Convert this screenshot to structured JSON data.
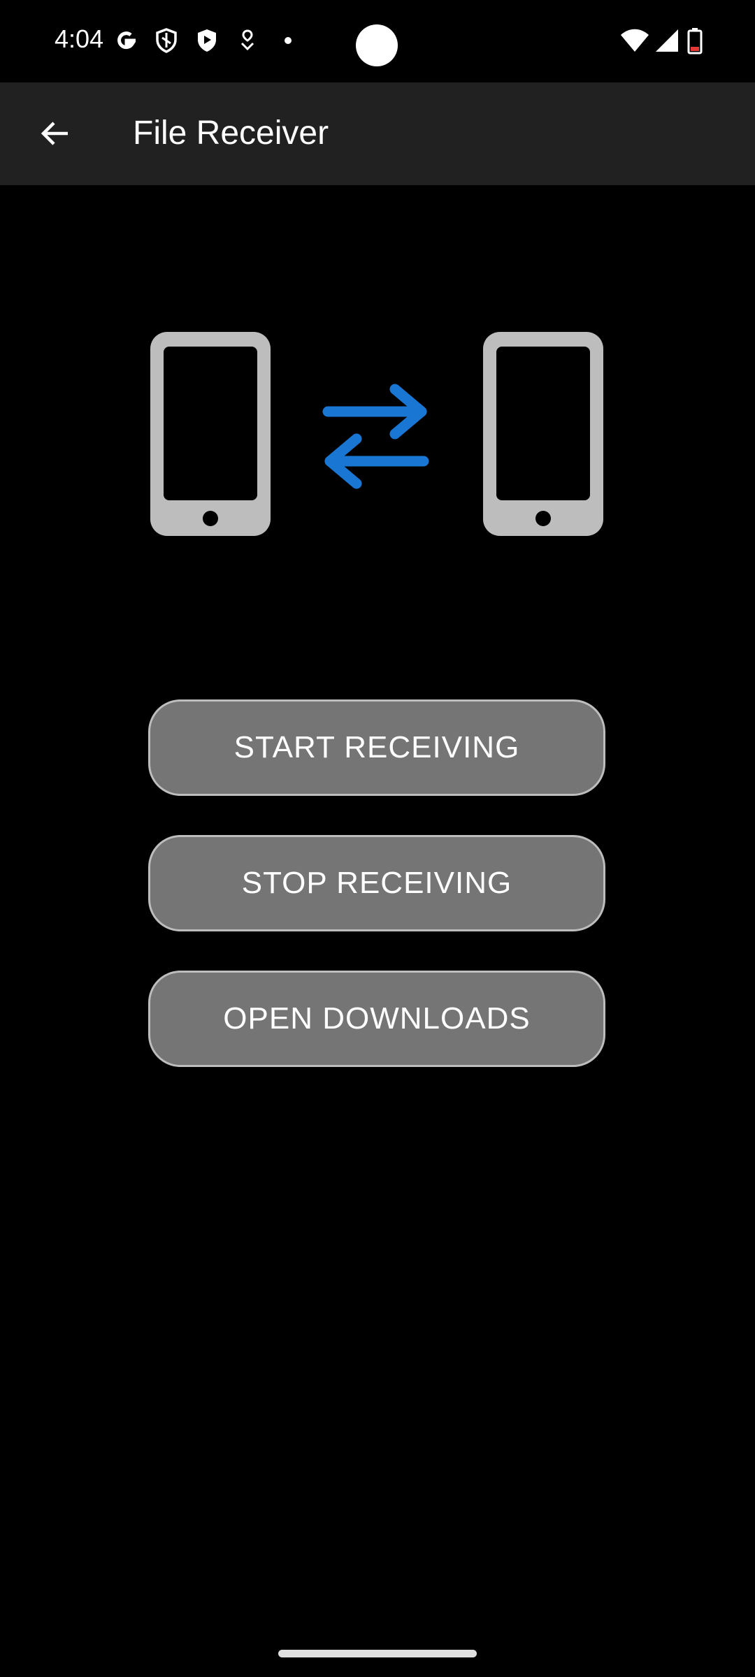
{
  "status_bar": {
    "time": "4:04",
    "left_icons": [
      "google-g-icon",
      "shield-outline-icon",
      "shield-play-icon",
      "heart-pin-icon",
      "dot-icon"
    ],
    "right_icons": [
      "wifi-icon",
      "cell-signal-icon",
      "battery-low-icon"
    ]
  },
  "app_bar": {
    "back_icon": "arrow-left-icon",
    "title": "File Receiver"
  },
  "illustration": {
    "icons": [
      "phone-left-icon",
      "transfer-arrows-icon",
      "phone-right-icon"
    ],
    "phone_color": "#bdbdbd",
    "arrow_color": "#1976d2"
  },
  "actions": {
    "start_label": "START RECEIVING",
    "stop_label": "STOP RECEIVING",
    "open_label": "OPEN DOWNLOADS"
  },
  "colors": {
    "background": "#000000",
    "app_bar": "#212121",
    "button_fill": "#757575",
    "button_border": "#bdbdbd"
  }
}
